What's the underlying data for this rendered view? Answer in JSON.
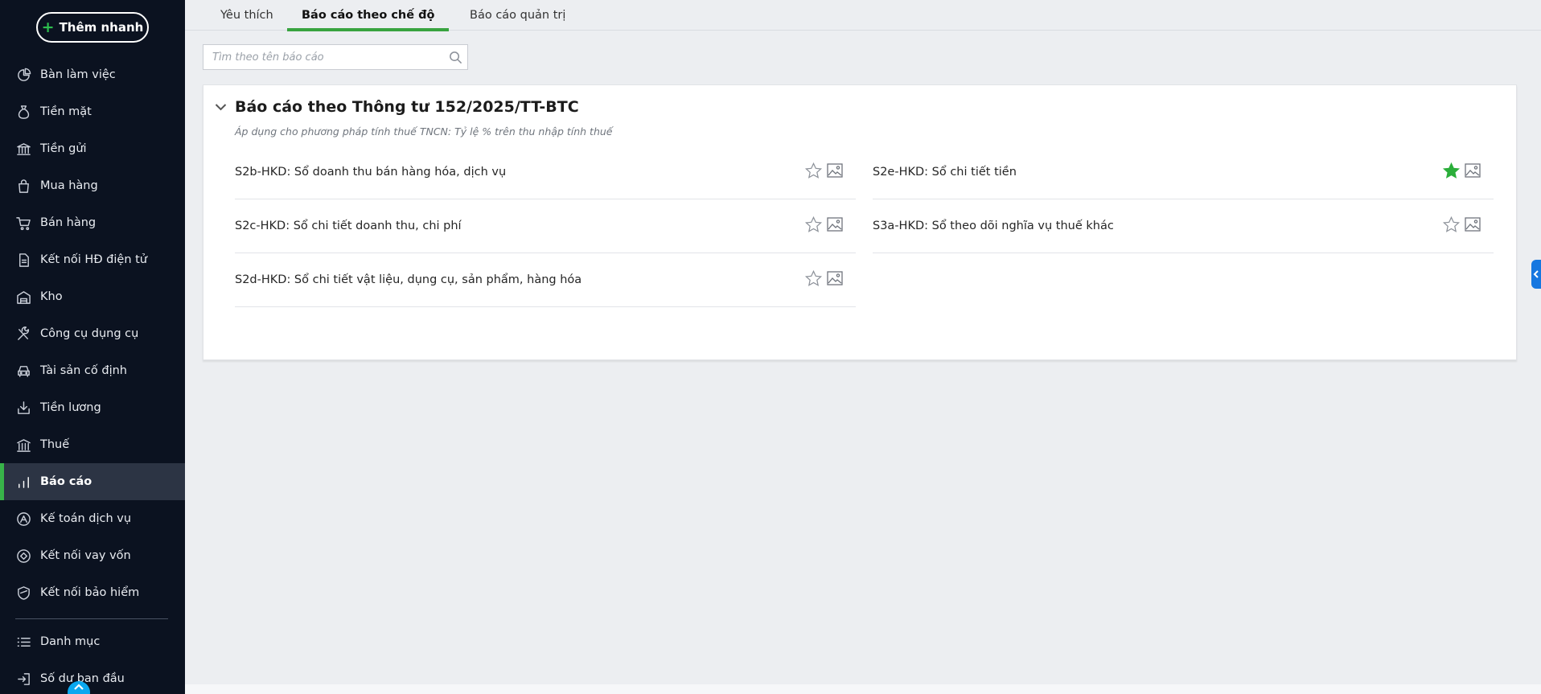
{
  "sidebar": {
    "quick_add_label": "Thêm nhanh",
    "items": [
      {
        "label": "Bàn làm việc",
        "icon": "dashboard-icon"
      },
      {
        "label": "Tiền mặt",
        "icon": "money-bag-icon"
      },
      {
        "label": "Tiền gửi",
        "icon": "bank-icon"
      },
      {
        "label": "Mua hàng",
        "icon": "shopping-bag-icon"
      },
      {
        "label": "Bán hàng",
        "icon": "cart-icon"
      },
      {
        "label": "Kết nối HĐ điện tử",
        "icon": "document-icon"
      },
      {
        "label": "Kho",
        "icon": "warehouse-icon"
      },
      {
        "label": "Công cụ dụng cụ",
        "icon": "tools-icon"
      },
      {
        "label": "Tài sản cố định",
        "icon": "car-icon"
      },
      {
        "label": "Tiền lương",
        "icon": "salary-icon"
      },
      {
        "label": "Thuế",
        "icon": "tax-building-icon"
      },
      {
        "label": "Báo cáo",
        "icon": "bar-chart-icon",
        "active": true
      },
      {
        "label": "Kế toán dịch vụ",
        "icon": "service-icon"
      },
      {
        "label": "Kết nối vay vốn",
        "icon": "loan-icon"
      },
      {
        "label": "Kết nối bảo hiểm",
        "icon": "shield-icon"
      }
    ],
    "bottom_items": [
      {
        "label": "Danh mục",
        "icon": "list-icon"
      },
      {
        "label": "Số dư ban đầu",
        "icon": "login-icon"
      }
    ]
  },
  "tabs": [
    {
      "label": "Yêu thích"
    },
    {
      "label": "Báo cáo theo chế độ",
      "active": true
    },
    {
      "label": "Báo cáo quản trị"
    }
  ],
  "search": {
    "placeholder": "Tìm theo tên báo cáo",
    "value": ""
  },
  "section": {
    "title": "Báo cáo theo Thông tư 152/2025/TT-BTC",
    "subtitle": "Áp dụng cho phương pháp tính thuế TNCN: Tỷ lệ % trên thu nhập tính thuế",
    "left_reports": [
      {
        "name": "S2b-HKD: Sổ doanh thu bán hàng hóa, dịch vụ",
        "favorite": false
      },
      {
        "name": "S2c-HKD: Sổ chi tiết doanh thu, chi phí",
        "favorite": false
      },
      {
        "name": "S2d-HKD: Sổ chi tiết vật liệu, dụng cụ, sản phẩm, hàng hóa",
        "favorite": false
      }
    ],
    "right_reports": [
      {
        "name": "S2e-HKD: Sổ chi tiết tiền",
        "favorite": true
      },
      {
        "name": "S3a-HKD: Sổ theo dõi nghĩa vụ thuế khác",
        "favorite": false
      }
    ]
  },
  "colors": {
    "sidebar_bg": "#0b1220",
    "accent_green": "#38b349",
    "favorite_star": "#2bae3a",
    "toggle_blue": "#1677e0"
  }
}
